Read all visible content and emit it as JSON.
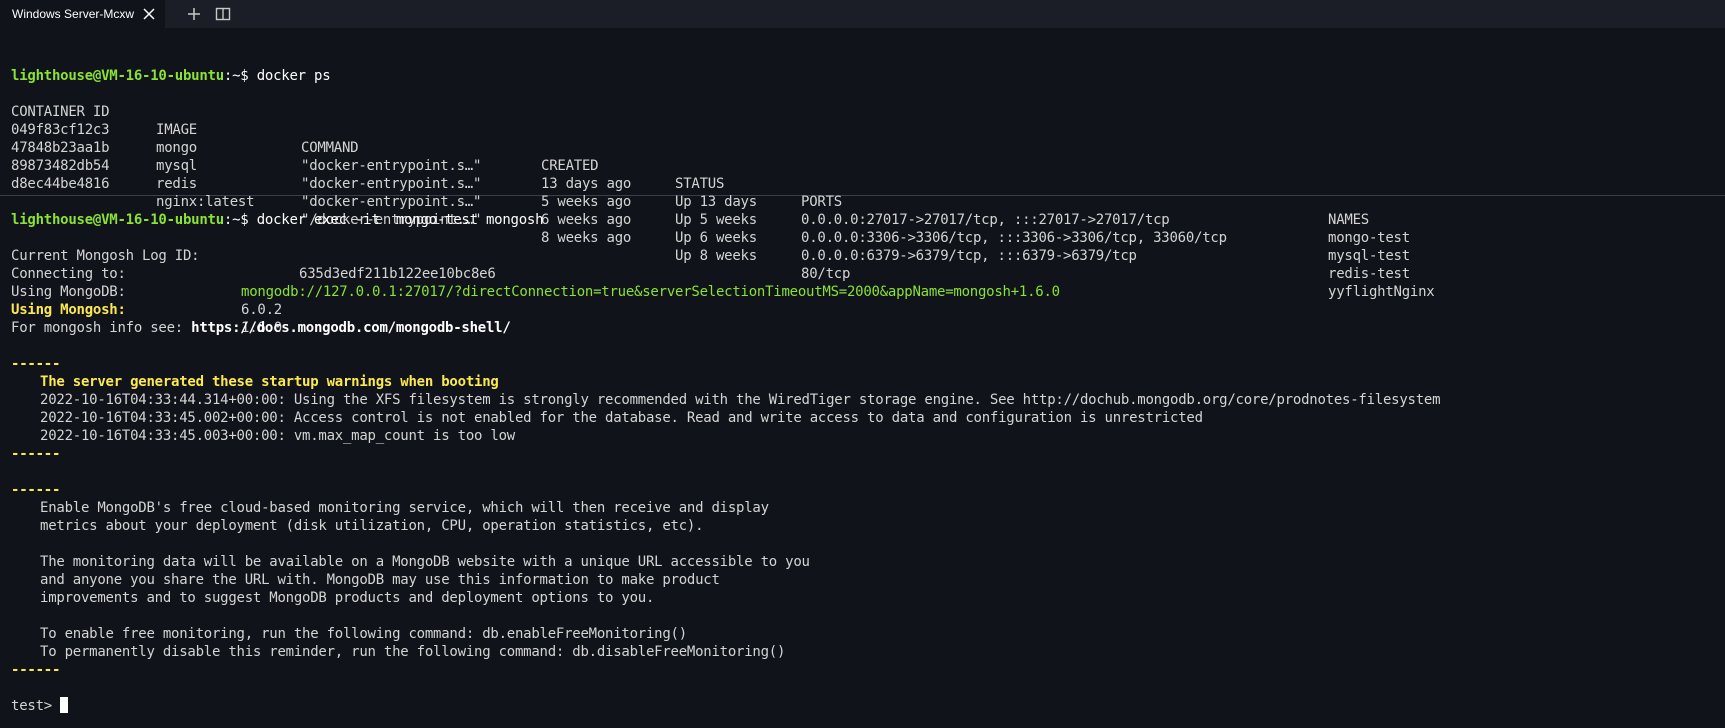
{
  "tab": {
    "title": "Windows Server-Mcxw"
  },
  "icons": {
    "close": "close-icon",
    "new_tab": "plus-icon",
    "split": "split-pane-icon"
  },
  "colors": {
    "background": "#10131a",
    "prompt_green": "#8ae234",
    "highlight_yellow": "#fce94f",
    "text": "#d4d4d4"
  },
  "prompt1": {
    "user": "lighthouse@VM-16-10-ubuntu",
    "path": ":~$ ",
    "command": "docker ps"
  },
  "docker_ps": {
    "headers": [
      "CONTAINER ID",
      "IMAGE",
      "COMMAND",
      "CREATED",
      "STATUS",
      "PORTS",
      "NAMES"
    ],
    "rows": [
      [
        "049f83cf12c3",
        "mongo",
        "\"docker-entrypoint.s…\"",
        "13 days ago",
        "Up 13 days",
        "0.0.0.0:27017->27017/tcp, :::27017->27017/tcp",
        "mongo-test"
      ],
      [
        "47848b23aa1b",
        "mysql",
        "\"docker-entrypoint.s…\"",
        "5 weeks ago",
        "Up 5 weeks",
        "0.0.0.0:3306->3306/tcp, :::3306->3306/tcp, 33060/tcp",
        "mysql-test"
      ],
      [
        "89873482db54",
        "redis",
        "\"docker-entrypoint.s…\"",
        "6 weeks ago",
        "Up 6 weeks",
        "0.0.0.0:6379->6379/tcp, :::6379->6379/tcp",
        "redis-test"
      ],
      [
        "d8ec44be4816",
        "nginx:latest",
        "\"/docker-entrypoint.…\"",
        "8 weeks ago",
        "Up 8 weeks",
        "80/tcp",
        "yyflightNginx"
      ]
    ]
  },
  "prompt2": {
    "user": "lighthouse@VM-16-10-ubuntu",
    "path": ":~$ ",
    "command": "docker exec -it  mongo-test mongosh"
  },
  "mongosh": {
    "log_label": "Current Mongosh Log ID:",
    "log_id": "635d3edf211b122ee10bc8e6",
    "connect_label": "Connecting to:",
    "connect_uri": "mongodb://127.0.0.1:27017/?directConnection=true&serverSelectionTimeoutMS=2000&appName=mongosh+1.6.0",
    "mongodb_label": "Using MongoDB:",
    "mongodb_version": "6.0.2",
    "mongosh_label": "Using Mongosh:",
    "mongosh_version": "1.6.0",
    "info_prefix": "For mongosh info see: ",
    "info_url": "https://docs.mongodb.com/mongodb-shell/"
  },
  "warnings": {
    "separator": "------",
    "heading": "The server generated these startup warnings when booting",
    "lines": [
      "2022-10-16T04:33:44.314+00:00: Using the XFS filesystem is strongly recommended with the WiredTiger storage engine. See http://dochub.mongodb.org/core/prodnotes-filesystem",
      "2022-10-16T04:33:45.002+00:00: Access control is not enabled for the database. Read and write access to data and configuration is unrestricted",
      "2022-10-16T04:33:45.003+00:00: vm.max_map_count is too low"
    ]
  },
  "monitoring": {
    "separator": "------",
    "lines": [
      "Enable MongoDB's free cloud-based monitoring service, which will then receive and display",
      "metrics about your deployment (disk utilization, CPU, operation statistics, etc).",
      "",
      "The monitoring data will be available on a MongoDB website with a unique URL accessible to you",
      "and anyone you share the URL with. MongoDB may use this information to make product",
      "improvements and to suggest MongoDB products and deployment options to you.",
      "",
      "To enable free monitoring, run the following command: db.enableFreeMonitoring()",
      "To permanently disable this reminder, run the following command: db.disableFreeMonitoring()"
    ]
  },
  "shell_prompt": "test> "
}
